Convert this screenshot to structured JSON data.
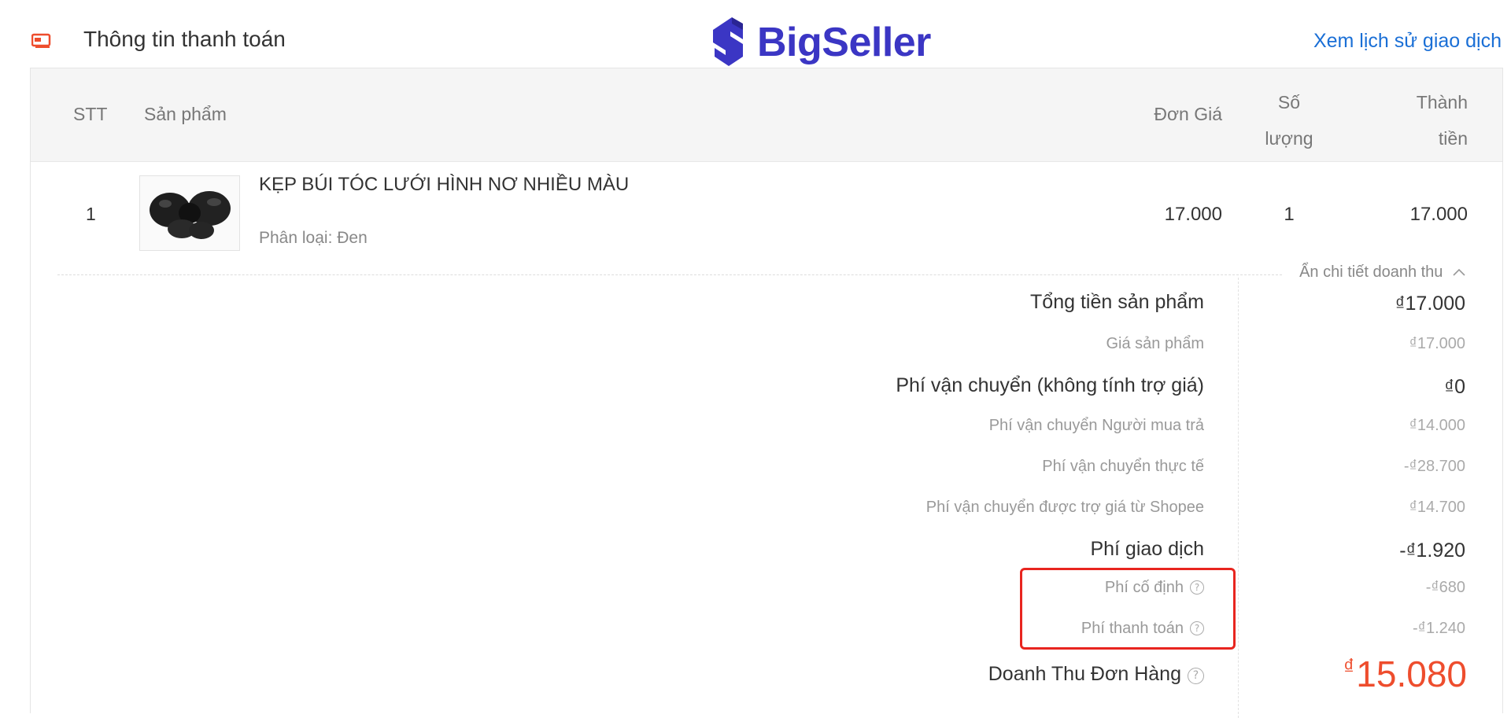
{
  "header": {
    "title": "Thông tin thanh toán",
    "logo_text": "BigSeller",
    "history_link": "Xem lịch sử giao dịch",
    "icon": "payment-card-icon"
  },
  "table": {
    "columns": {
      "stt": "STT",
      "product": "Sản phẩm",
      "unit_price": "Đơn Giá",
      "qty_line1": "Số",
      "qty_line2": "lượng",
      "total_line1": "Thành",
      "total_line2": "tiền"
    },
    "rows": [
      {
        "stt": "1",
        "name": "KẸP BÚI TÓC LƯỚI HÌNH NƠ NHIỀU MÀU",
        "variant": "Phân loại: Đen",
        "unit_price": "17.000",
        "qty": "1",
        "total": "17.000",
        "image_icon": "bow-hair-clip-icon"
      }
    ]
  },
  "revenue_toggle": "Ẩn chi tiết doanh thu",
  "breakdown": {
    "product_total_label": "Tổng tiền sản phẩm",
    "product_total_value": "₫17.000",
    "product_price_label": "Giá sản phẩm",
    "product_price_value": "₫17.000",
    "shipping_label": "Phí vận chuyển (không tính trợ giá)",
    "shipping_value": "₫0",
    "buyer_shipping_label": "Phí vận chuyển Người mua trả",
    "buyer_shipping_value": "₫14.000",
    "actual_shipping_label": "Phí vận chuyển thực tế",
    "actual_shipping_value": "-₫28.700",
    "shopee_subsidy_label": "Phí vận chuyển được trợ giá từ Shopee",
    "shopee_subsidy_value": "₫14.700",
    "transaction_fee_label": "Phí giao dịch",
    "transaction_fee_value": "-₫1.920",
    "fixed_fee_label": "Phí cố định",
    "fixed_fee_value": "-₫680",
    "payment_fee_label": "Phí thanh toán",
    "payment_fee_value": "-₫1.240",
    "revenue_label": "Doanh Thu Đơn Hàng",
    "revenue_currency": "₫",
    "revenue_value": "15.080"
  },
  "colors": {
    "brand": "#3b36c4",
    "link": "#1a6fd6",
    "accent": "#ee4d2d",
    "highlight_box": "#e8251f"
  }
}
